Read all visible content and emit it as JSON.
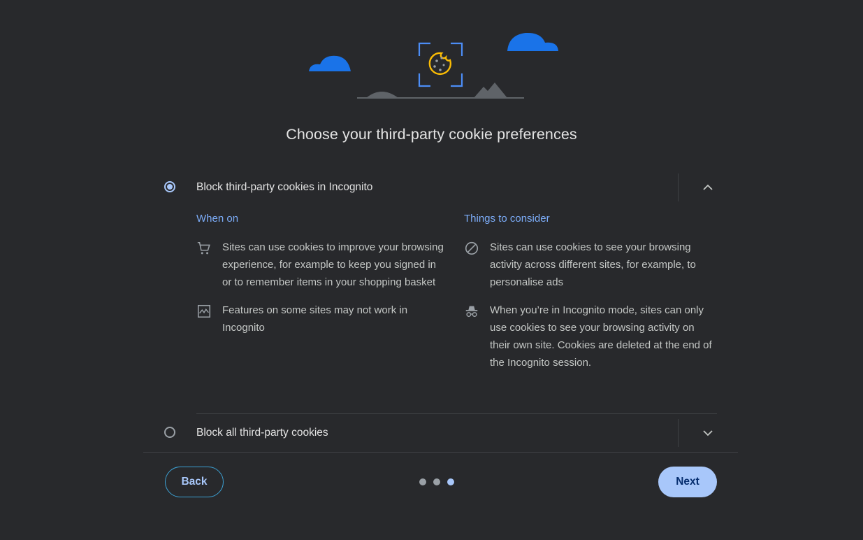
{
  "title": "Choose your third-party cookie preferences",
  "options": [
    {
      "label": "Block third-party cookies in Incognito",
      "selected": true,
      "expanded": true,
      "when_on": {
        "heading": "When on",
        "items": [
          {
            "icon": "shopping-cart-icon",
            "text": "Sites can use cookies to improve your browsing experience, for example to keep you signed in or to remember items in your shopping basket"
          },
          {
            "icon": "broken-image-icon",
            "text": "Features on some sites may not work in Incognito"
          }
        ]
      },
      "things_to_consider": {
        "heading": "Things to consider",
        "items": [
          {
            "icon": "block-icon",
            "text": "Sites can use cookies to see your browsing activity across different sites, for example, to personalise ads"
          },
          {
            "icon": "incognito-icon",
            "text": "When you’re in Incognito mode, sites can only use cookies to see your browsing activity on their own site. Cookies are deleted at the end of the Incognito session."
          }
        ]
      }
    },
    {
      "label": "Block all third-party cookies",
      "selected": false,
      "expanded": false
    }
  ],
  "footer": {
    "back_label": "Back",
    "next_label": "Next",
    "steps_total": 3,
    "current_step": 3
  },
  "colors": {
    "background": "#28292c",
    "accent": "#a8c7fa",
    "link_blue": "#7cacf8",
    "cloud_blue": "#1a73e8",
    "cookie_yellow": "#fbbc04"
  }
}
